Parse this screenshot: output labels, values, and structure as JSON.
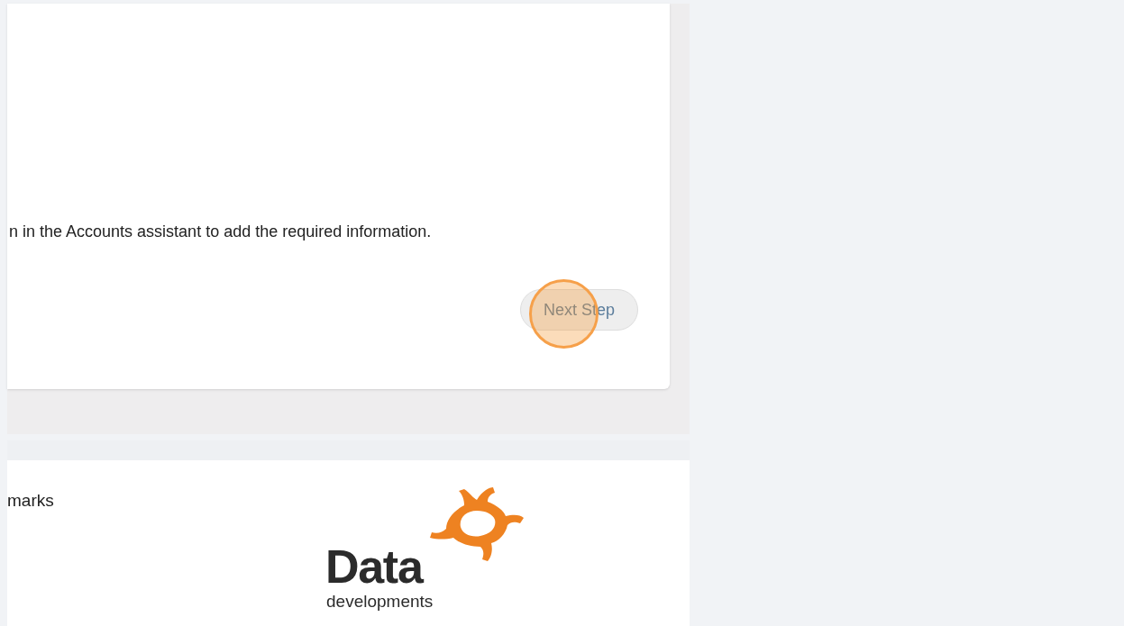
{
  "card": {
    "message": "n in the Accounts assistant to add the required information.",
    "button": {
      "label": "Next Step",
      "disabled": true
    },
    "click_marker": true
  },
  "footer": {
    "text": "marks",
    "logo": {
      "name": "Data",
      "tagline": "developments"
    }
  }
}
